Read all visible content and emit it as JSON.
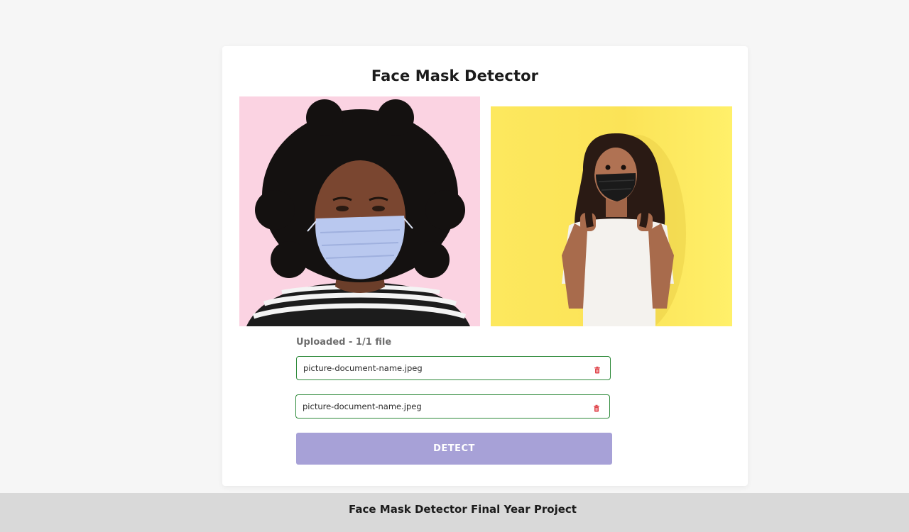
{
  "page": {
    "title": "Face Mask Detector"
  },
  "images": {
    "left": {
      "description_icon": "woman-pink-background-blue-mask-photo",
      "bg_color": "#fbd3e2"
    },
    "right": {
      "description_icon": "woman-yellow-background-black-mask-photo",
      "bg_color": "#fde85e"
    }
  },
  "upload": {
    "status_label": "Uploaded - 1/1 file",
    "files": [
      {
        "name": "picture-document-name.jpeg",
        "icon": "trash-icon"
      },
      {
        "name": "picture-document-name.jpeg",
        "icon": "trash-icon"
      }
    ],
    "border_color": "#2e8a3a",
    "delete_icon_color": "#e0464c"
  },
  "actions": {
    "detect_label": "DETECT",
    "detect_color": "#a7a1d7"
  },
  "footer": {
    "text": "Face Mask Detector Final Year Project"
  }
}
